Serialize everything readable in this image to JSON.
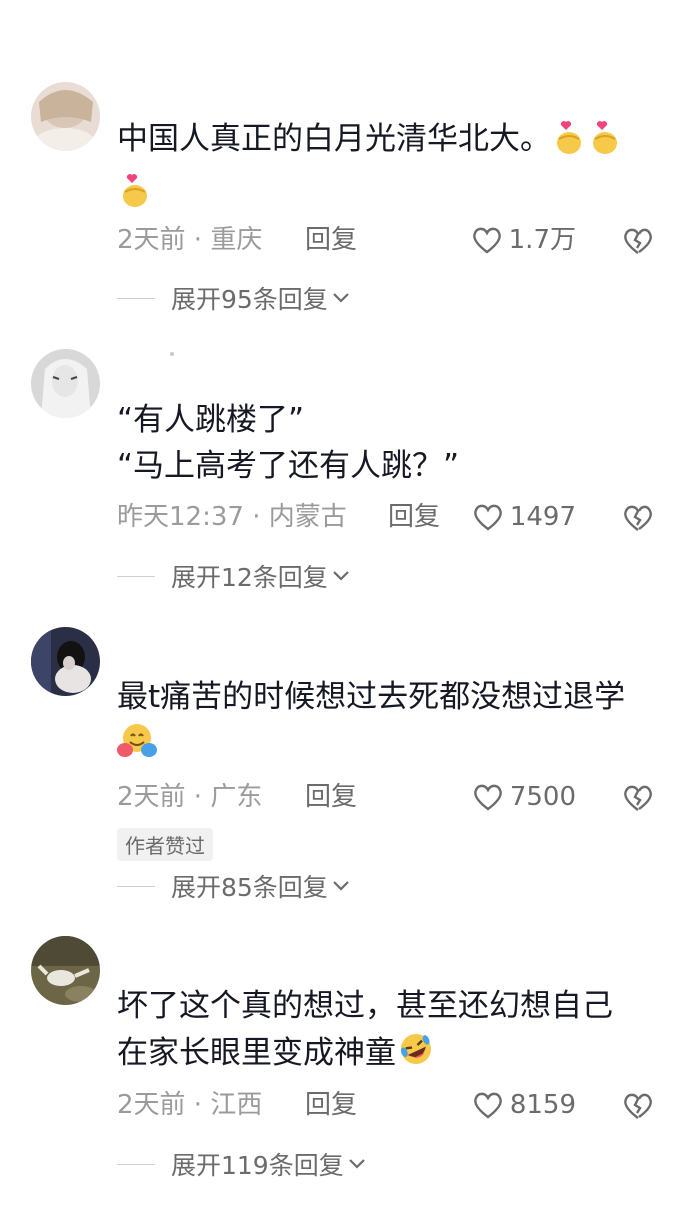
{
  "comments": [
    {
      "text": "中国人真正的白月光清华北大。",
      "time_loc": "2天前 · 重庆",
      "reply": "回复",
      "likes": "1.7万",
      "expand": "展开95条回复",
      "emoji_names": [
        "finger-heart-emoji",
        "finger-heart-emoji",
        "finger-heart-emoji"
      ]
    },
    {
      "text_line1": "“有人跳楼了”",
      "text_line2": "“马上高考了还有人跳？”",
      "time_loc": "昨天12:37 · 内蒙古",
      "reply": "回复",
      "likes": "1497",
      "expand": "展开12条回复"
    },
    {
      "text": "最t痛苦的时候想过去死都没想过退学",
      "time_loc": "2天前 · 广东",
      "reply": "回复",
      "likes": "7500",
      "badge": "作者赞过",
      "expand": "展开85条回复",
      "emoji_names": [
        "hugging-face-emoji"
      ]
    },
    {
      "text_line1": "坏了这个真的想过，甚至还幻想自己",
      "text_line2": "在家长眼里变成神童",
      "time_loc": "2天前 · 江西",
      "reply": "回复",
      "likes": "8159",
      "expand": "展开119条回复",
      "emoji_names": [
        "rolling-laughing-emoji"
      ]
    }
  ],
  "colors": {
    "text": "#161823",
    "meta": "#9b9b9b",
    "action": "#6b6b6b",
    "badge_bg": "#f1f1f1"
  }
}
